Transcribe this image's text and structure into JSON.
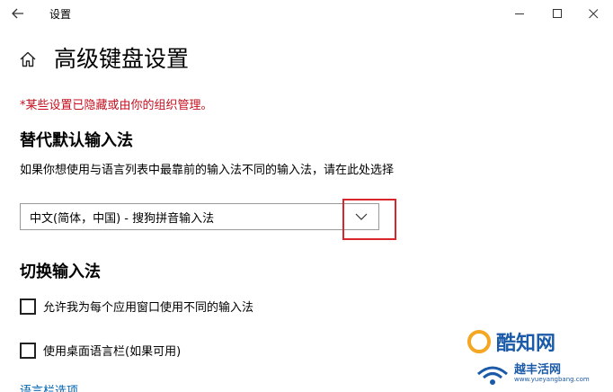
{
  "window": {
    "title": "设置",
    "back_icon": "back-arrow-icon",
    "controls": [
      "minimize-icon",
      "maximize-icon",
      "close-icon"
    ]
  },
  "page": {
    "home_icon": "home-icon",
    "title": "高级键盘设置",
    "managed_note": "*某些设置已隐藏或由你的组织管理。"
  },
  "default_input": {
    "heading": "替代默认输入法",
    "description": "如果你想使用与语言列表中最靠前的输入法不同的输入法，请在此处选择",
    "dropdown_value": "中文(简体，中国) - 搜狗拼音输入法"
  },
  "switch_input": {
    "heading": "切换输入法",
    "checkboxes": [
      {
        "label": "允许我为每个应用窗口使用不同的输入法",
        "checked": false
      },
      {
        "label": "使用桌面语言栏(如果可用)",
        "checked": false
      }
    ],
    "link": "语言栏选项"
  },
  "watermarks": {
    "primary": "酷知网",
    "secondary": "越丰活网",
    "url": "www.yueyangbang.com"
  },
  "colors": {
    "warning": "#c50f1f",
    "link": "#0063b1",
    "highlight": "#d9262c"
  }
}
